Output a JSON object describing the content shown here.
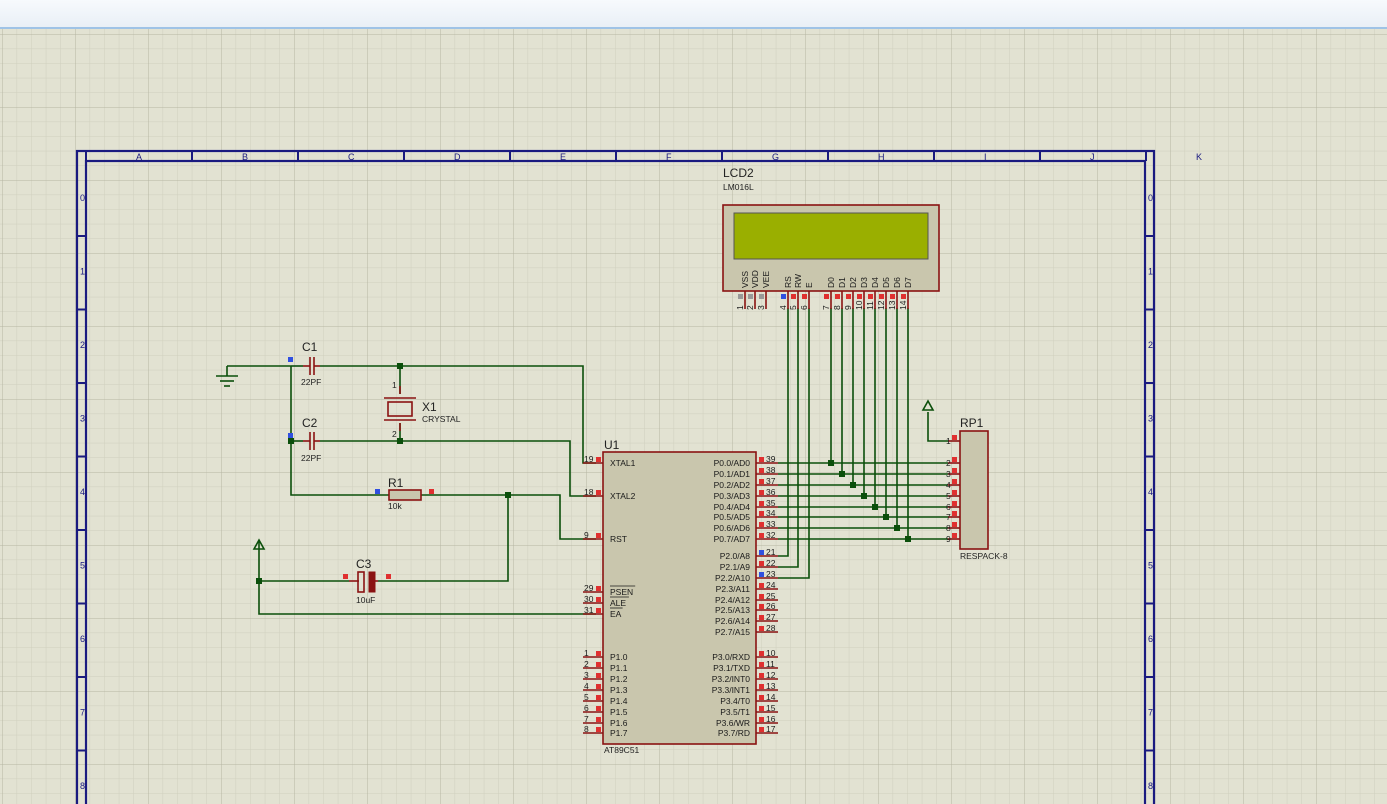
{
  "window": {
    "title": ""
  },
  "frame": {
    "columns": [
      "A",
      "B",
      "C",
      "D",
      "E",
      "F",
      "G",
      "H",
      "I",
      "J",
      "K"
    ],
    "rows": [
      "0",
      "1",
      "2",
      "3",
      "4",
      "5",
      "6",
      "7",
      "8"
    ]
  },
  "components": {
    "lcd": {
      "ref": "LCD2",
      "value": "LM016L",
      "pins": [
        {
          "name": "VSS",
          "num": "1"
        },
        {
          "name": "VDD",
          "num": "2"
        },
        {
          "name": "VEE",
          "num": "3"
        },
        {
          "name": "RS",
          "num": "4"
        },
        {
          "name": "RW",
          "num": "5"
        },
        {
          "name": "E",
          "num": "6"
        },
        {
          "name": "D0",
          "num": "7"
        },
        {
          "name": "D1",
          "num": "8"
        },
        {
          "name": "D2",
          "num": "9"
        },
        {
          "name": "D3",
          "num": "10"
        },
        {
          "name": "D4",
          "num": "11"
        },
        {
          "name": "D5",
          "num": "12"
        },
        {
          "name": "D6",
          "num": "13"
        },
        {
          "name": "D7",
          "num": "14"
        }
      ],
      "screen_color": "#9aaf00"
    },
    "c1": {
      "ref": "C1",
      "value": "22PF"
    },
    "c2": {
      "ref": "C2",
      "value": "22PF"
    },
    "c3": {
      "ref": "C3",
      "value": "10uF"
    },
    "x1": {
      "ref": "X1",
      "value": "CRYSTAL",
      "pin1": "1",
      "pin2": "2"
    },
    "r1": {
      "ref": "R1",
      "value": "10k"
    },
    "rp1": {
      "ref": "RP1",
      "value": "RESPACK-8",
      "pins": [
        "1",
        "2",
        "3",
        "4",
        "5",
        "6",
        "7",
        "8",
        "9"
      ]
    },
    "u1": {
      "ref": "U1",
      "value": "AT89C51",
      "left_pins": [
        {
          "num": "19",
          "name": "XTAL1"
        },
        {
          "num": "18",
          "name": "XTAL2"
        },
        {
          "num": "9",
          "name": "RST"
        },
        {
          "num": "29",
          "name": "PSEN"
        },
        {
          "num": "30",
          "name": "ALE"
        },
        {
          "num": "31",
          "name": "EA"
        },
        {
          "num": "1",
          "name": "P1.0"
        },
        {
          "num": "2",
          "name": "P1.1"
        },
        {
          "num": "3",
          "name": "P1.2"
        },
        {
          "num": "4",
          "name": "P1.3"
        },
        {
          "num": "5",
          "name": "P1.4"
        },
        {
          "num": "6",
          "name": "P1.5"
        },
        {
          "num": "7",
          "name": "P1.6"
        },
        {
          "num": "8",
          "name": "P1.7"
        }
      ],
      "right_pins": [
        {
          "num": "39",
          "name": "P0.0/AD0"
        },
        {
          "num": "38",
          "name": "P0.1/AD1"
        },
        {
          "num": "37",
          "name": "P0.2/AD2"
        },
        {
          "num": "36",
          "name": "P0.3/AD3"
        },
        {
          "num": "35",
          "name": "P0.4/AD4"
        },
        {
          "num": "34",
          "name": "P0.5/AD5"
        },
        {
          "num": "33",
          "name": "P0.6/AD6"
        },
        {
          "num": "32",
          "name": "P0.7/AD7"
        },
        {
          "num": "21",
          "name": "P2.0/A8"
        },
        {
          "num": "22",
          "name": "P2.1/A9"
        },
        {
          "num": "23",
          "name": "P2.2/A10"
        },
        {
          "num": "24",
          "name": "P2.3/A11"
        },
        {
          "num": "25",
          "name": "P2.4/A12"
        },
        {
          "num": "26",
          "name": "P2.5/A13"
        },
        {
          "num": "27",
          "name": "P2.6/A14"
        },
        {
          "num": "28",
          "name": "P2.7/A15"
        },
        {
          "num": "10",
          "name": "P3.0/RXD"
        },
        {
          "num": "11",
          "name": "P3.1/TXD"
        },
        {
          "num": "12",
          "name": "P3.2/INT0"
        },
        {
          "num": "13",
          "name": "P3.3/INT1"
        },
        {
          "num": "14",
          "name": "P3.4/T0"
        },
        {
          "num": "15",
          "name": "P3.5/T1"
        },
        {
          "num": "16",
          "name": "P3.6/WR"
        },
        {
          "num": "17",
          "name": "P3.7/RD"
        }
      ]
    }
  },
  "colors": {
    "background": "#e2e2d2",
    "grid_minor": "#cfcfbd",
    "grid_major": "#b8b8a6",
    "frame": "#1a1a80",
    "wire": "#0b4f0b",
    "component": "#8a1212",
    "component_fill": "#c9c6ad",
    "pin_marker": "#e03030",
    "pin_marker_selected": "#3050e0"
  }
}
